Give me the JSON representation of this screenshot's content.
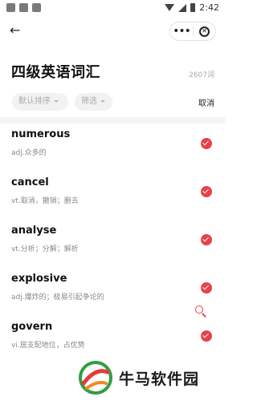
{
  "status_bar": {
    "time": "2:42"
  },
  "nav": {
    "back_glyph": "←",
    "more_glyph": "•••",
    "close_glyph": "✕"
  },
  "header": {
    "title": "四级英语词汇",
    "count": "2607词"
  },
  "filters": {
    "sort_label": "默认排序",
    "filter_label": "筛选",
    "cancel_label": "取消"
  },
  "words": [
    {
      "word": "numerous",
      "meaning": "adj.众多的"
    },
    {
      "word": "cancel",
      "meaning": "vt.取消，撤销；删去"
    },
    {
      "word": "analyse",
      "meaning": "vt.分析；分解；解析"
    },
    {
      "word": "explosive",
      "meaning": "adj.爆炸的；极易引起争论的"
    },
    {
      "word": "govern",
      "meaning": "vi.居支配地位，占优势"
    }
  ],
  "watermark": {
    "text": "牛马软件园"
  },
  "colors": {
    "accent": "#e8414d",
    "chip_bg": "#f2f2f2",
    "divider": "#f4f4f4"
  }
}
